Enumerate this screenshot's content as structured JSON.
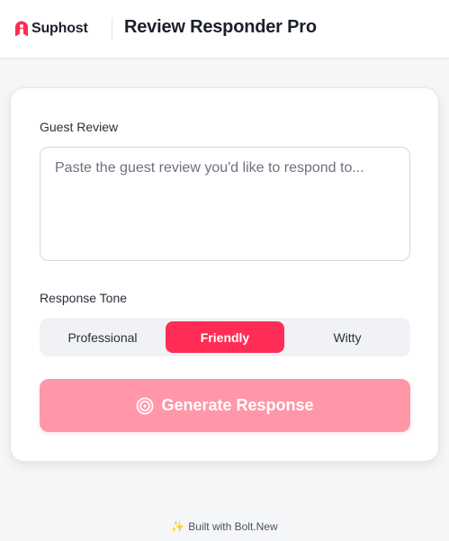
{
  "header": {
    "brand_name": "Suphost",
    "app_title": "Review Responder Pro",
    "brand_color": "#ff2d55"
  },
  "form": {
    "review_label": "Guest Review",
    "review_placeholder": "Paste the guest review you'd like to respond to...",
    "review_value": "",
    "tone_label": "Response Tone",
    "tones": [
      {
        "label": "Professional",
        "selected": false
      },
      {
        "label": "Friendly",
        "selected": true
      },
      {
        "label": "Witty",
        "selected": false
      }
    ],
    "generate_label": "Generate Response",
    "generate_icon": "target-icon",
    "generate_disabled": true
  },
  "footer": {
    "spark_icon": "sparkles-icon",
    "text": "Built with Bolt.New"
  }
}
